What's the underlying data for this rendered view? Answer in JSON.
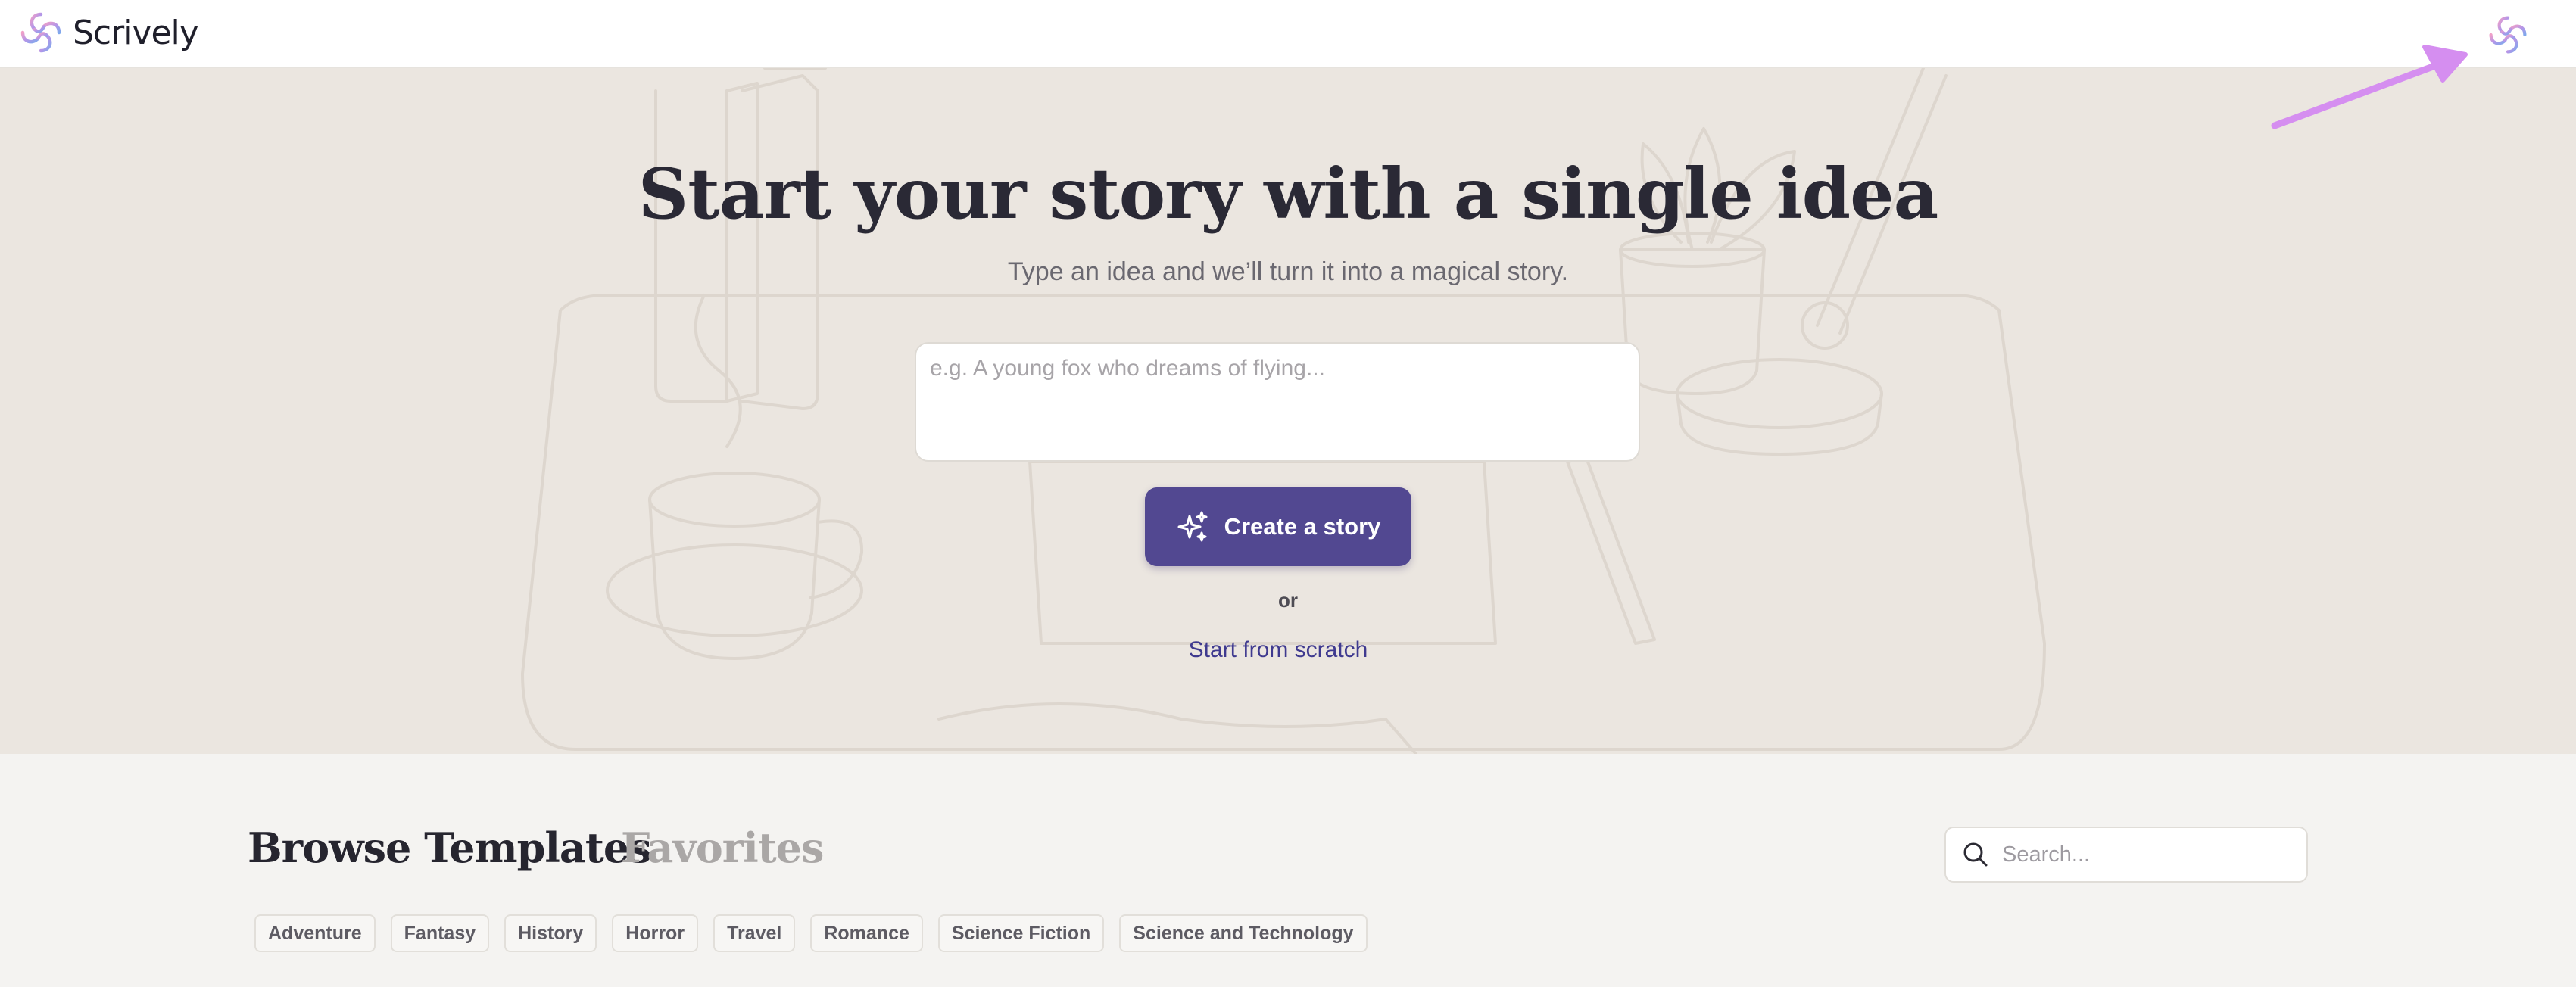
{
  "header": {
    "brand_name": "Scrively",
    "brand_icon": "swirl-logo-icon",
    "account_icon": "swirl-logo-icon"
  },
  "hero": {
    "title": "Start your story with a single idea",
    "subtitle": "Type an idea and we’ll turn it into a magical story.",
    "input_placeholder": "e.g. A young fox who dreams of flying...",
    "input_value": "",
    "create_button_label": "Create a story",
    "create_button_icon": "sparkles-icon",
    "or_text": "or",
    "scratch_link_label": "Start from scratch"
  },
  "templates": {
    "tabs": [
      {
        "label": "Browse Templates",
        "active": true
      },
      {
        "label": "Favorites",
        "active": false
      }
    ],
    "search_placeholder": "Search...",
    "categories": [
      "Adventure",
      "Fantasy",
      "History",
      "Horror",
      "Travel",
      "Romance",
      "Science Fiction",
      "Science and Technology"
    ]
  },
  "colors": {
    "primary": "#524891",
    "link": "#3f3a8f",
    "hero_background": "#ebe6e0",
    "annotation_arrow": "#d58ef0"
  }
}
